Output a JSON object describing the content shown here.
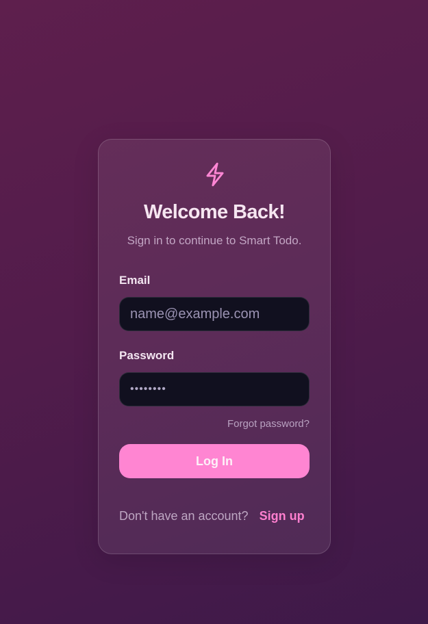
{
  "login": {
    "title": "Welcome Back!",
    "subtitle": "Sign in to continue to Smart Todo.",
    "email_label": "Email",
    "email_placeholder": "name@example.com",
    "email_value": "",
    "password_label": "Password",
    "password_value": "••••••••",
    "forgot_label": "Forgot password?",
    "login_button": "Log In",
    "signup_prompt": "Don't have an account?",
    "signup_link": "Sign up"
  },
  "icons": {
    "logo": "lightning-bolt-icon"
  },
  "colors": {
    "accent": "#ff85d2",
    "link": "#ff7fcf",
    "input_bg": "#11101f",
    "card_border": "#ffffff29",
    "background_start": "#5e1f4d",
    "background_end": "#3e1949"
  }
}
